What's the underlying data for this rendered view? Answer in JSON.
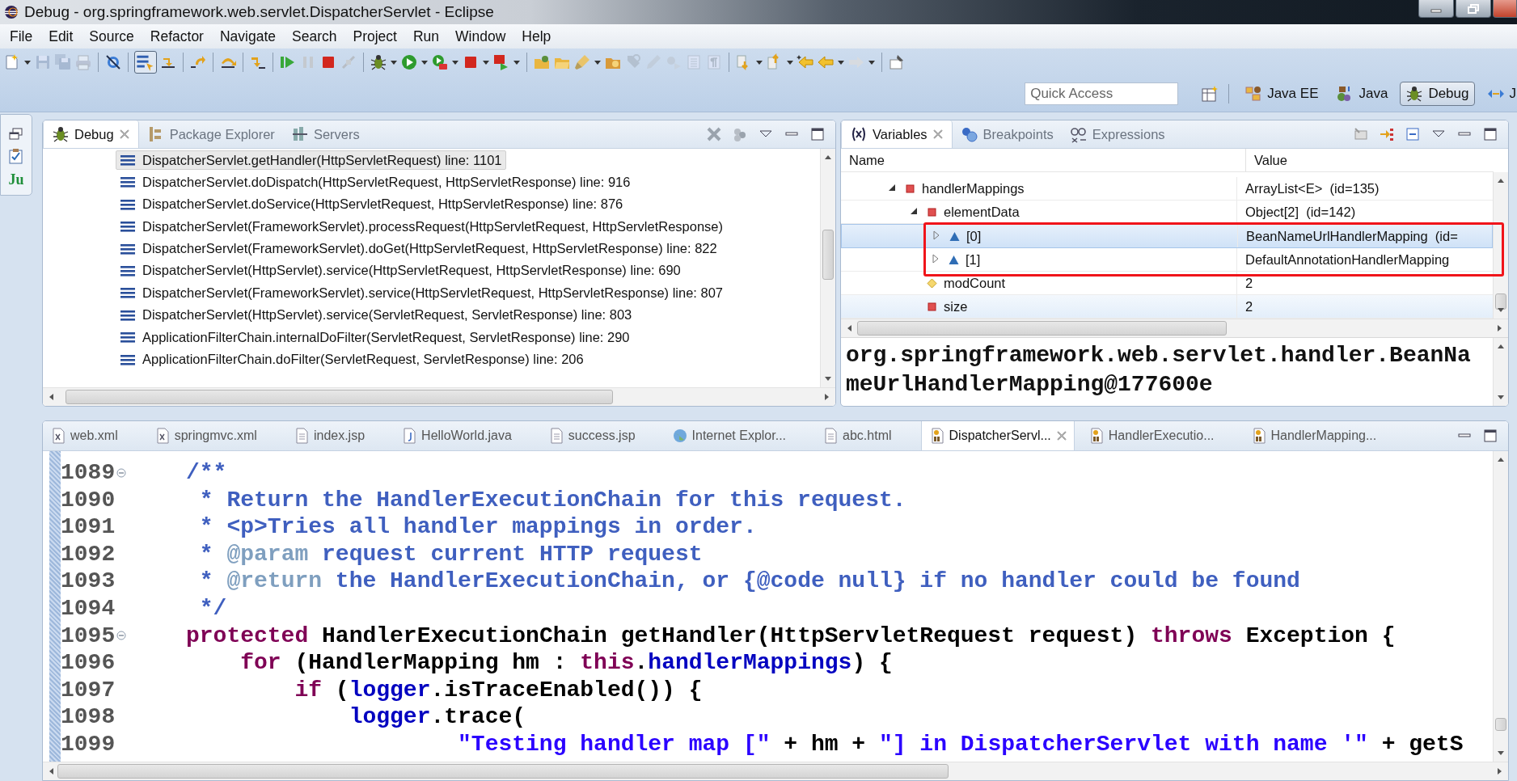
{
  "window": {
    "title": "Debug - org.springframework.web.servlet.DispatcherServlet - Eclipse"
  },
  "menu": [
    "File",
    "Edit",
    "Source",
    "Refactor",
    "Navigate",
    "Search",
    "Project",
    "Run",
    "Window",
    "Help"
  ],
  "toolbar": {
    "step_filters": {
      "on": true
    }
  },
  "quick_access": {
    "placeholder": "Quick Access"
  },
  "perspectives": [
    {
      "label": "Java EE",
      "kind": "javaee",
      "selected": false
    },
    {
      "label": "Java",
      "kind": "java",
      "selected": false
    },
    {
      "label": "Debug",
      "kind": "debug",
      "selected": true
    },
    {
      "label": "J",
      "kind": "browsing",
      "selected": false
    }
  ],
  "trim_stack": {
    "junit_label": "Ju"
  },
  "debug_view": {
    "tabs": [
      {
        "label": "Debug",
        "kind": "debug",
        "selected": true
      },
      {
        "label": "Package Explorer",
        "kind": "packages",
        "selected": false
      },
      {
        "label": "Servers",
        "kind": "servers",
        "selected": false
      }
    ],
    "frames": [
      {
        "text": "DispatcherServlet.getHandler(HttpServletRequest) line: 1101",
        "selected": true
      },
      {
        "text": "DispatcherServlet.doDispatch(HttpServletRequest, HttpServletResponse) line: 916",
        "selected": false
      },
      {
        "text": "DispatcherServlet.doService(HttpServletRequest, HttpServletResponse) line: 876",
        "selected": false
      },
      {
        "text": "DispatcherServlet(FrameworkServlet).processRequest(HttpServletRequest, HttpServletResponse)",
        "selected": false
      },
      {
        "text": "DispatcherServlet(FrameworkServlet).doGet(HttpServletRequest, HttpServletResponse) line: 822",
        "selected": false
      },
      {
        "text": "DispatcherServlet(HttpServlet).service(HttpServletRequest, HttpServletResponse) line: 690",
        "selected": false
      },
      {
        "text": "DispatcherServlet(FrameworkServlet).service(HttpServletRequest, HttpServletResponse) line: 807",
        "selected": false
      },
      {
        "text": "DispatcherServlet(HttpServlet).service(ServletRequest, ServletResponse) line: 803",
        "selected": false
      },
      {
        "text": "ApplicationFilterChain.internalDoFilter(ServletRequest, ServletResponse) line: 290",
        "selected": false
      },
      {
        "text": "ApplicationFilterChain.doFilter(ServletRequest, ServletResponse) line: 206",
        "selected": false
      }
    ]
  },
  "variables_view": {
    "tabs": [
      {
        "label": "Variables",
        "kind": "variables",
        "selected": true
      },
      {
        "label": "Breakpoints",
        "kind": "breakpoints",
        "selected": false
      },
      {
        "label": "Expressions",
        "kind": "expressions",
        "selected": false
      }
    ],
    "columns": [
      "Name",
      "Value"
    ],
    "tree": [
      {
        "name": "handlerMappings",
        "value": "ArrayList<E>  (id=135)",
        "kind": "private",
        "expanded": true,
        "selected": false,
        "hovered": false,
        "boxed": false,
        "children": [
          {
            "name": "elementData",
            "value": "Object[2]  (id=142)",
            "kind": "private",
            "expanded": true,
            "selected": false,
            "hovered": false,
            "boxed": false,
            "children": [
              {
                "name": "[0]",
                "value": "BeanNameUrlHandlerMapping  (id=",
                "kind": "package",
                "expanded": false,
                "selected": true,
                "hovered": false,
                "boxed": true
              },
              {
                "name": "[1]",
                "value": "DefaultAnnotationHandlerMapping",
                "kind": "package",
                "expanded": false,
                "selected": false,
                "hovered": false,
                "boxed": true
              }
            ]
          },
          {
            "name": "modCount",
            "value": "2",
            "kind": "protected",
            "selected": false,
            "hovered": false,
            "boxed": false
          },
          {
            "name": "size",
            "value": "2",
            "kind": "private",
            "selected": false,
            "hovered": true,
            "boxed": false
          }
        ]
      }
    ],
    "detail": "org.springframework.web.servlet.handler.BeanNameUrlHandlerMapping@177600e"
  },
  "editor": {
    "tabs": [
      {
        "label": "web.xml",
        "kind": "xml",
        "selected": false
      },
      {
        "label": "springmvc.xml",
        "kind": "xml",
        "selected": false
      },
      {
        "label": "index.jsp",
        "kind": "jsp",
        "selected": false
      },
      {
        "label": "HelloWorld.java",
        "kind": "java",
        "selected": false
      },
      {
        "label": "success.jsp",
        "kind": "jsp",
        "selected": false
      },
      {
        "label": "Internet Explor...",
        "kind": "browser",
        "selected": false
      },
      {
        "label": "abc.html",
        "kind": "jsp",
        "selected": false
      },
      {
        "label": "DispatcherServl...",
        "kind": "class",
        "selected": true
      },
      {
        "label": "HandlerExecutio...",
        "kind": "class",
        "selected": false
      },
      {
        "label": "HandlerMapping...",
        "kind": "class",
        "selected": false
      }
    ],
    "lines": [
      {
        "number": "1089",
        "folded": false,
        "tokens": [
          {
            "kind": "comment",
            "text": "/**"
          }
        ]
      },
      {
        "number": "1090",
        "tokens": [
          {
            "kind": "comment",
            "text": " * Return the HandlerExecutionChain for this request."
          }
        ]
      },
      {
        "number": "1091",
        "tokens": [
          {
            "kind": "comment",
            "text": " * <p>Tries all handler mappings in order."
          }
        ]
      },
      {
        "number": "1092",
        "tokens": [
          {
            "kind": "comment",
            "text": " * "
          },
          {
            "kind": "doctag",
            "text": "@param"
          },
          {
            "kind": "comment",
            "text": " request current HTTP request"
          }
        ]
      },
      {
        "number": "1093",
        "tokens": [
          {
            "kind": "comment",
            "text": " * "
          },
          {
            "kind": "doctag",
            "text": "@return"
          },
          {
            "kind": "comment",
            "text": " the HandlerExecutionChain, or {@code null} if no handler could be found"
          }
        ]
      },
      {
        "number": "1094",
        "tokens": [
          {
            "kind": "comment",
            "text": " */"
          }
        ]
      },
      {
        "number": "1095",
        "folded": false,
        "tokens": [
          {
            "kind": "keyword",
            "text": "protected"
          },
          {
            "kind": "plain",
            "text": " HandlerExecutionChain getHandler(HttpServletRequest request) "
          },
          {
            "kind": "keyword",
            "text": "throws"
          },
          {
            "kind": "plain",
            "text": " Exception {"
          }
        ]
      },
      {
        "number": "1096",
        "tokens": [
          {
            "kind": "keyword",
            "text": "    for"
          },
          {
            "kind": "plain",
            "text": " (HandlerMapping hm : "
          },
          {
            "kind": "keyword",
            "text": "this"
          },
          {
            "kind": "plain",
            "text": "."
          },
          {
            "kind": "field",
            "text": "handlerMappings"
          },
          {
            "kind": "plain",
            "text": ") {"
          }
        ]
      },
      {
        "number": "1097",
        "tokens": [
          {
            "kind": "keyword",
            "text": "        if"
          },
          {
            "kind": "plain",
            "text": " ("
          },
          {
            "kind": "field",
            "text": "logger"
          },
          {
            "kind": "plain",
            "text": ".isTraceEnabled()) {"
          }
        ]
      },
      {
        "number": "1098",
        "tokens": [
          {
            "kind": "field",
            "text": "            logger"
          },
          {
            "kind": "plain",
            "text": ".trace("
          }
        ]
      },
      {
        "number": "1099",
        "tokens": [
          {
            "kind": "string",
            "text": "                    \"Testing handler map [\""
          },
          {
            "kind": "plain",
            "text": " + hm + "
          },
          {
            "kind": "string",
            "text": "\"] in DispatcherServlet with name '\""
          },
          {
            "kind": "plain",
            "text": " + getS"
          }
        ]
      }
    ]
  }
}
